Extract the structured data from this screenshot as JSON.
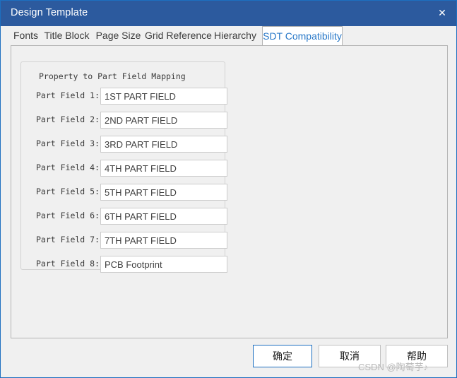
{
  "window": {
    "title": "Design Template",
    "close_icon": "close-icon",
    "close_glyph": "✕",
    "accent_color": "#2c5a9e",
    "border_color": "#1d6fc0",
    "background_color": "#f0f0f0"
  },
  "tabs": [
    {
      "label": "Fonts",
      "active": false
    },
    {
      "label": "Title Block",
      "active": false
    },
    {
      "label": "Page Size",
      "active": false
    },
    {
      "label": "Grid Reference",
      "active": false
    },
    {
      "label": "Hierarchy",
      "active": false
    },
    {
      "label": "SDT Compatibility",
      "active": true
    }
  ],
  "group": {
    "label": "Property to Part Field Mapping",
    "rows": [
      {
        "label": "Part Field 1:",
        "value": "1ST PART FIELD"
      },
      {
        "label": "Part Field 2:",
        "value": "2ND PART FIELD"
      },
      {
        "label": "Part Field 3:",
        "value": "3RD PART FIELD"
      },
      {
        "label": "Part Field 4:",
        "value": "4TH PART FIELD"
      },
      {
        "label": "Part Field 5:",
        "value": "5TH PART FIELD"
      },
      {
        "label": "Part Field 6:",
        "value": "6TH PART FIELD"
      },
      {
        "label": "Part Field 7:",
        "value": "7TH PART FIELD"
      },
      {
        "label": "Part Field 8:",
        "value": "PCB Footprint"
      }
    ]
  },
  "buttons": {
    "ok": "确定",
    "cancel": "取消",
    "help": "帮助"
  },
  "watermark": "CSDN @陶萄芋♪"
}
